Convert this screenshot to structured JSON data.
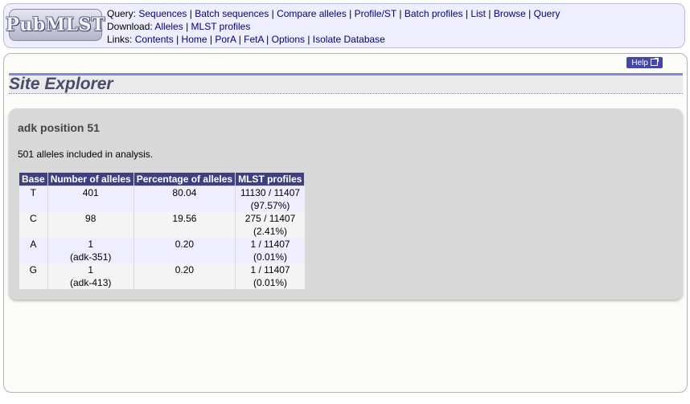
{
  "logo_text": "PubMLST",
  "menu": {
    "query_label": "Query:",
    "query_links": [
      "Sequences",
      "Batch sequences",
      "Compare alleles",
      "Profile/ST",
      "Batch profiles",
      "List",
      "Browse",
      "Query"
    ],
    "download_label": "Download:",
    "download_links": [
      "Alleles",
      "MLST profiles"
    ],
    "links_label": "Links:",
    "links_links": [
      "Contents",
      "Home",
      "PorA",
      "FetA",
      "Options",
      "Isolate Database"
    ]
  },
  "help_label": "Help",
  "page_title": "Site Explorer",
  "section": {
    "heading": "adk position 51",
    "summary": "501 alleles included in analysis."
  },
  "table": {
    "headers": [
      "Base",
      "Number of alleles",
      "Percentage of alleles",
      "MLST profiles"
    ],
    "rows": [
      {
        "base": "T",
        "alleles": "401",
        "allele_note": "",
        "percentage": "80.04",
        "profiles": "11130 / 11407",
        "profiles_pct": "(97.57%)"
      },
      {
        "base": "C",
        "alleles": "98",
        "allele_note": "",
        "percentage": "19.56",
        "profiles": "275 / 11407",
        "profiles_pct": "(2.41%)"
      },
      {
        "base": "A",
        "alleles": "1",
        "allele_note": "(adk-351)",
        "percentage": "0.20",
        "profiles": "1 / 11407",
        "profiles_pct": "(0.01%)"
      },
      {
        "base": "G",
        "alleles": "1",
        "allele_note": "(adk-413)",
        "percentage": "0.20",
        "profiles": "1 / 11407",
        "profiles_pct": "(0.01%)"
      }
    ]
  },
  "colors": {
    "table_header": "#404080",
    "link": "#000080",
    "title_rule": "#8888cc"
  }
}
